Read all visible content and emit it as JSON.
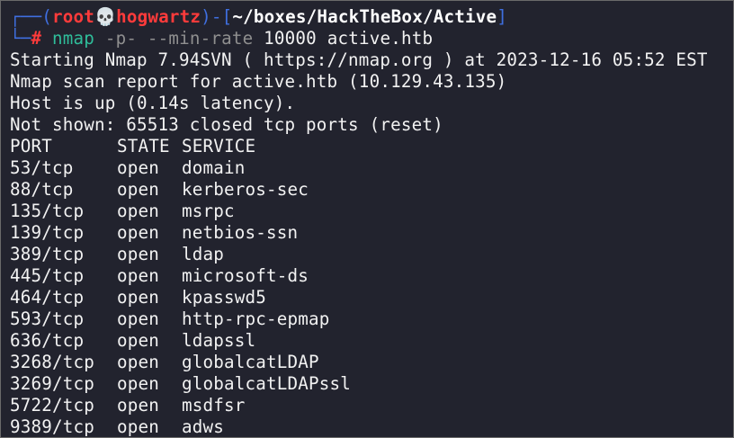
{
  "prompt": {
    "line1_prefix": "┌──(",
    "user": "root",
    "skull_icon": "💀",
    "host": "hogwartz",
    "line1_mid": ")-[",
    "path": "~/boxes/HackTheBox/Active",
    "line1_suffix": "]",
    "line2_prefix": "└─",
    "hash": "#",
    "command": {
      "bin": "nmap",
      "flag1": "-p-",
      "flag2": "--min-rate",
      "arg1": "10000",
      "arg2": "active.htb"
    }
  },
  "output": {
    "line1": "Starting Nmap 7.94SVN ( https://nmap.org ) at 2023-12-16 05:52 EST",
    "line2": "Nmap scan report for active.htb (10.129.43.135)",
    "line3": "Host is up (0.14s latency).",
    "line4": "Not shown: 65513 closed tcp ports (reset)"
  },
  "table": {
    "headers": {
      "port": "PORT",
      "state": "STATE",
      "service": "SERVICE"
    },
    "rows": [
      {
        "port": "53/tcp",
        "state": "open",
        "service": "domain"
      },
      {
        "port": "88/tcp",
        "state": "open",
        "service": "kerberos-sec"
      },
      {
        "port": "135/tcp",
        "state": "open",
        "service": "msrpc"
      },
      {
        "port": "139/tcp",
        "state": "open",
        "service": "netbios-ssn"
      },
      {
        "port": "389/tcp",
        "state": "open",
        "service": "ldap"
      },
      {
        "port": "445/tcp",
        "state": "open",
        "service": "microsoft-ds"
      },
      {
        "port": "464/tcp",
        "state": "open",
        "service": "kpasswd5"
      },
      {
        "port": "593/tcp",
        "state": "open",
        "service": "http-rpc-epmap"
      },
      {
        "port": "636/tcp",
        "state": "open",
        "service": "ldapssl"
      },
      {
        "port": "3268/tcp",
        "state": "open",
        "service": "globalcatLDAP"
      },
      {
        "port": "3269/tcp",
        "state": "open",
        "service": "globalcatLDAPssl"
      },
      {
        "port": "5722/tcp",
        "state": "open",
        "service": "msdfsr"
      },
      {
        "port": "9389/tcp",
        "state": "open",
        "service": "adws"
      }
    ]
  },
  "colors": {
    "background": "#22232e",
    "prompt_frame": "#3f6fe0",
    "prompt_user": "#ff3b3b",
    "command": "#2fbd9a",
    "flags": "#8f8f8f",
    "text": "#f2f2f2"
  }
}
